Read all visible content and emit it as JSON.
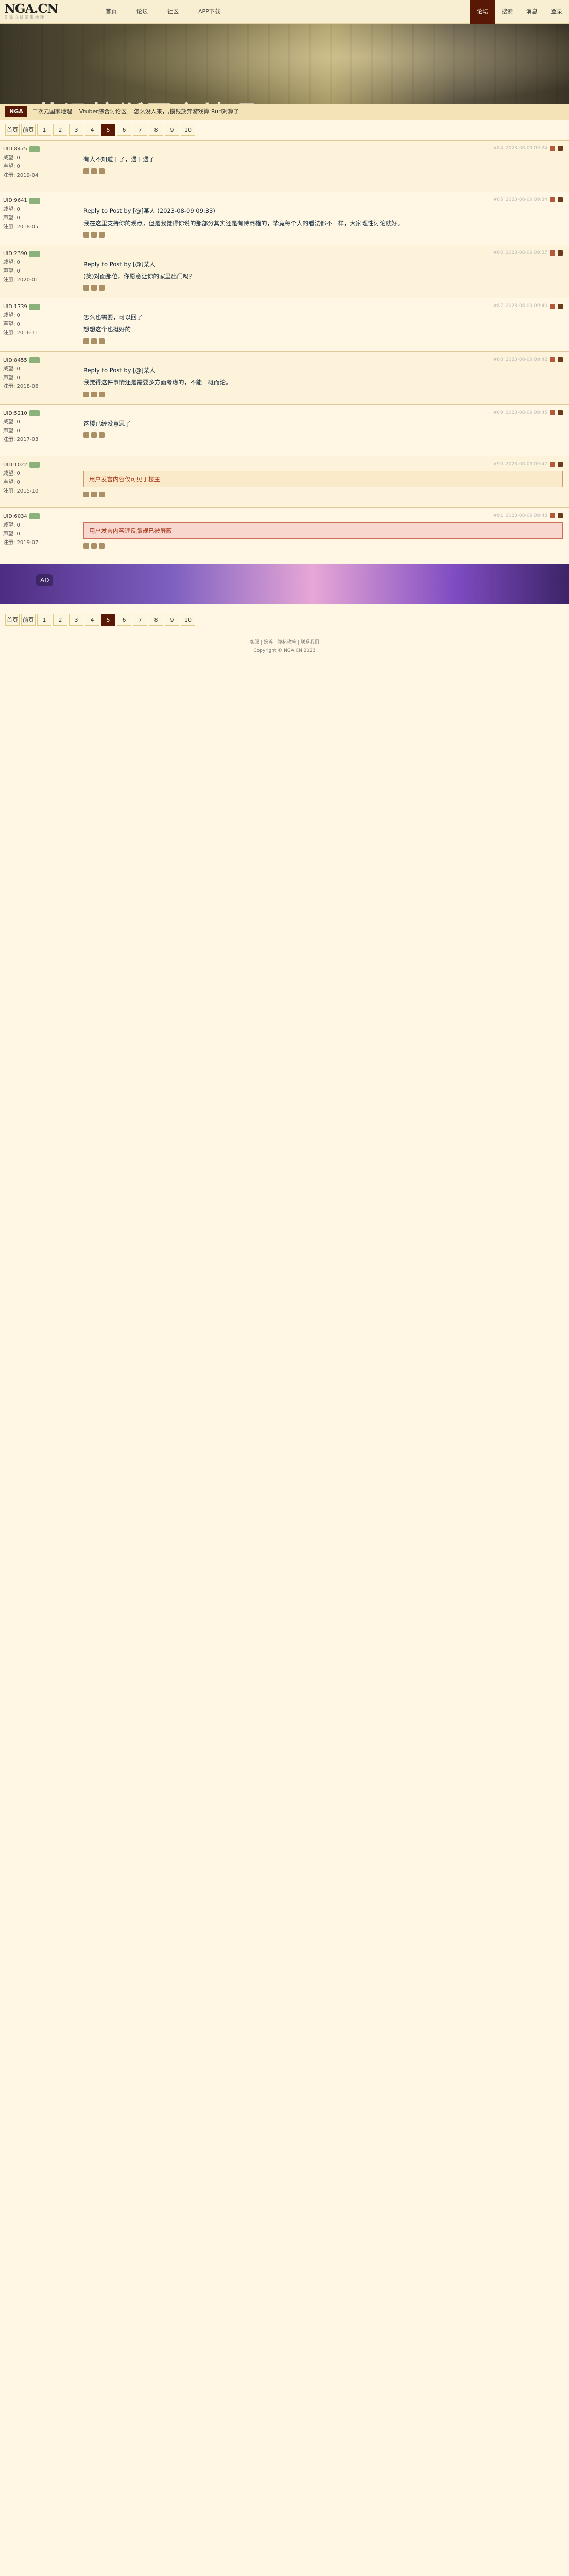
{
  "nav": {
    "logo": "NGA.CN",
    "logo_sub": "艾泽拉斯国家地理",
    "links": [
      "首页",
      "论坛",
      "社区",
      "APP下载"
    ],
    "right": [
      "论坛",
      "搜索",
      "消息",
      "登录"
    ]
  },
  "banner": {
    "title": "艾泽拉斯国家地理",
    "home_tag": "NGA",
    "sub_links": [
      "二次元国家地理",
      "Vtuber综合讨论区",
      "怎么没人来，,攒钱放弃游戏算 Ruri对算了"
    ]
  },
  "pager": {
    "items": [
      "首页",
      "前页",
      "1",
      "2",
      "3",
      "4",
      "5",
      "6",
      "7",
      "8",
      "9",
      "10"
    ],
    "current": "5"
  },
  "posts": [
    {
      "uid": "UID:8475",
      "lv": "威望: 0",
      "rep": "声望: 0",
      "reg": "注册: 2019-04",
      "floor": "#84",
      "time": "2023-08-09 09:24",
      "content": [
        "有人不知道干了，遇干遇了"
      ]
    },
    {
      "uid": "UID:9641",
      "lv": "威望: 0",
      "rep": "声望: 0",
      "reg": "注册: 2018-05",
      "floor": "#85",
      "time": "2023-08-09 09:34",
      "content": [
        "Reply to Post by [@]某人 (2023-08-09 09:33)",
        "我在这里支持你的观点，但是我觉得你说的那部分其实还是有待商榷的，毕竟每个人的看法都不一样，大家理性讨论就好。"
      ]
    },
    {
      "uid": "UID:2390",
      "lv": "威望: 0",
      "rep": "声望: 0",
      "reg": "注册: 2020-01",
      "floor": "#86",
      "time": "2023-08-09 09:37",
      "content": [
        "Reply to Post by [@]某人",
        "(笑)对面那位，你愿意让你的家里出门吗？"
      ]
    },
    {
      "uid": "UID:1739",
      "lv": "威望: 0",
      "rep": "声望: 0",
      "reg": "注册: 2016-11",
      "floor": "#87",
      "time": "2023-08-09 09:40",
      "content": [
        "怎么也需要，可以回了",
        "想想这个也挺好的"
      ]
    },
    {
      "uid": "UID:8455",
      "lv": "威望: 0",
      "rep": "声望: 0",
      "reg": "注册: 2018-06",
      "floor": "#88",
      "time": "2023-08-09 09:42",
      "content": [
        "Reply to Post by [@]某人",
        "我觉得这件事情还是需要多方面考虑的，不能一概而论。"
      ]
    },
    {
      "uid": "UID:5210",
      "lv": "威望: 0",
      "rep": "声望: 0",
      "reg": "注册: 2017-03",
      "floor": "#89",
      "time": "2023-08-09 09:45",
      "content": [
        "这楼已经没意思了"
      ]
    },
    {
      "uid": "UID:1022",
      "lv": "威望: 0",
      "rep": "声望: 0",
      "reg": "注册: 2015-10",
      "floor": "#90",
      "time": "2023-08-09 09:47",
      "content": [
        "用户发言内容仅可见于楼主"
      ]
    },
    {
      "uid": "UID:6034",
      "lv": "威望: 0",
      "rep": "声望: 0",
      "reg": "注册: 2019-07",
      "floor": "#91",
      "time": "2023-08-09 09:48",
      "content": [
        "用户发言内容违反版规已被屏蔽"
      ]
    }
  ],
  "footer": {
    "line1": "客服 | 投诉 | 隐私政策 | 联系我们",
    "line2": "Copyright © NGA.CN 2023"
  }
}
